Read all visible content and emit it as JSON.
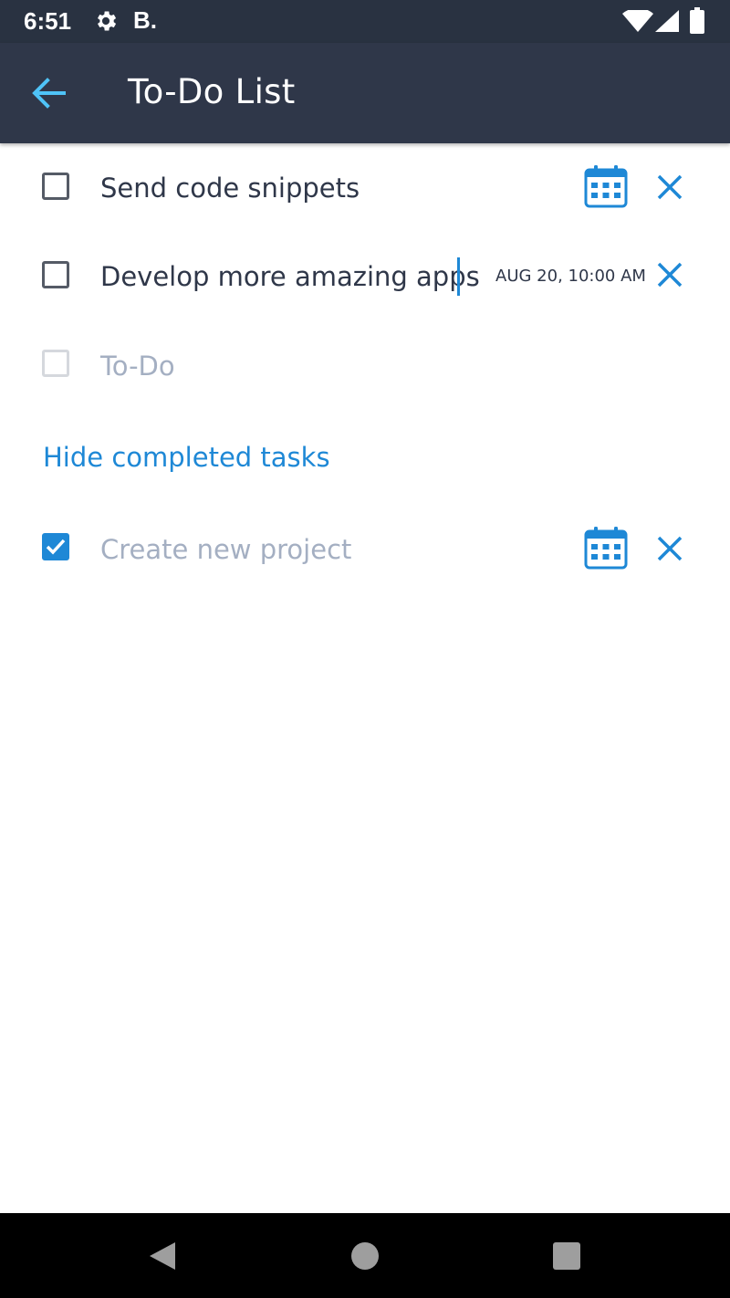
{
  "status_bar": {
    "time": "6:51",
    "app_indicator": "B.",
    "icons": [
      "gear-icon",
      "wifi-icon",
      "signal-icon",
      "battery-icon"
    ]
  },
  "app_bar": {
    "title": "To-Do List",
    "back_icon": "arrow-left-icon"
  },
  "tasks": [
    {
      "text": "Send code snippets",
      "checked": false,
      "due": ""
    },
    {
      "text": "Develop more amazing apps",
      "checked": false,
      "due": "AUG 20, 10:00 AM"
    }
  ],
  "new_task": {
    "placeholder": "To-Do"
  },
  "toggle_completed_label": "Hide completed tasks",
  "completed_tasks": [
    {
      "text": "Create new project",
      "checked": true
    }
  ],
  "nav_bar": {
    "icons": [
      "back-triangle-icon",
      "home-circle-icon",
      "recents-square-icon"
    ]
  },
  "colors": {
    "status_bar": "#293241",
    "app_bar": "#2f3749",
    "accent": "#1e88d6",
    "back_arrow": "#4fc3f7",
    "task_text": "#2f3749",
    "muted_text": "#a4afc2"
  }
}
